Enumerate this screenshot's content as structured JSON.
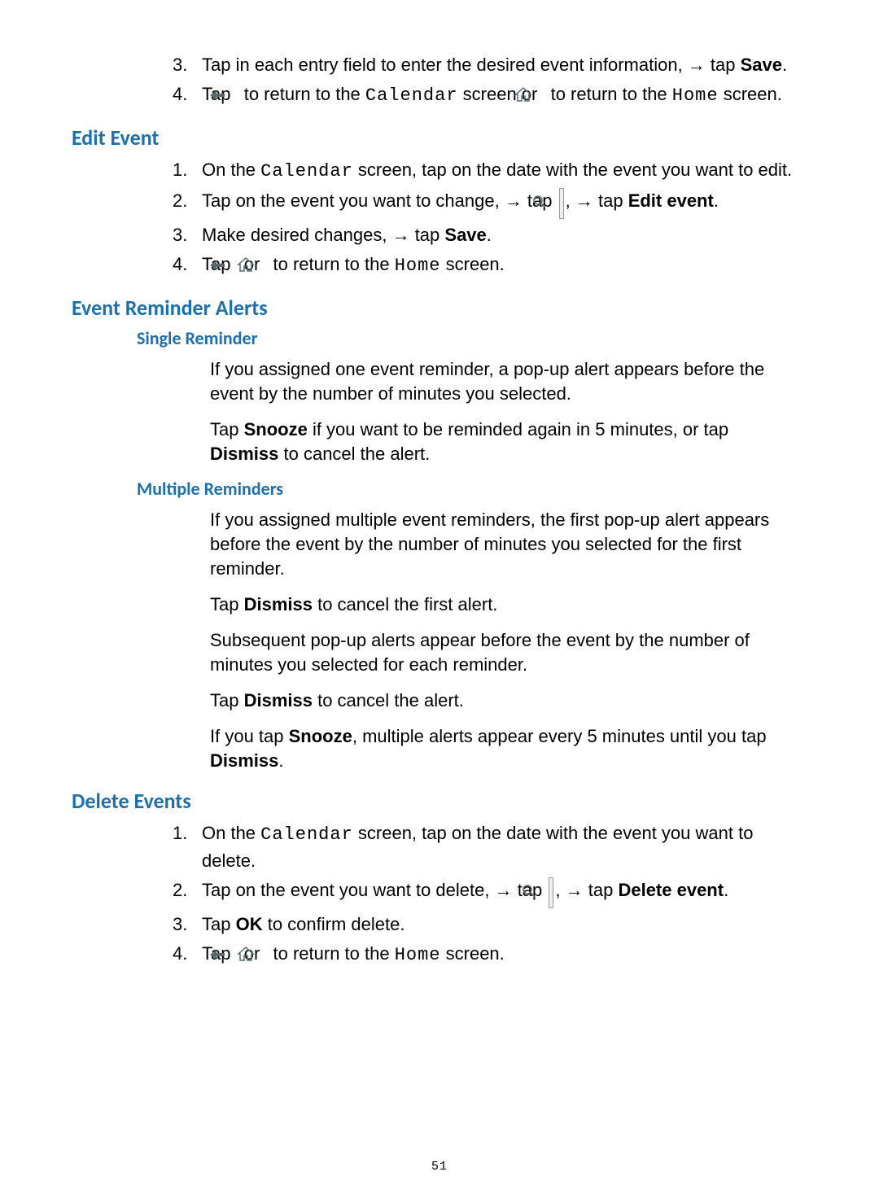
{
  "page_number": "51",
  "intro_steps": [
    {
      "n": "3.",
      "parts": [
        {
          "t": "Tap in each entry field to enter the desired event information, → tap "
        },
        {
          "t": "Save",
          "bold": true
        },
        {
          "t": "."
        }
      ]
    },
    {
      "n": "4.",
      "parts": [
        {
          "t": "Tap "
        },
        {
          "icon": "back-arrow-icon"
        },
        {
          "t": " to return to the "
        },
        {
          "t": "Calendar",
          "mono": true
        },
        {
          "t": " screen or "
        },
        {
          "icon": "home-icon"
        },
        {
          "t": " to return to the "
        },
        {
          "t": "Home",
          "mono": true
        },
        {
          "t": " screen."
        }
      ]
    }
  ],
  "sections": [
    {
      "heading": "Edit Event",
      "steps": [
        {
          "n": "1.",
          "parts": [
            {
              "t": "On the "
            },
            {
              "t": "Calendar",
              "mono": true
            },
            {
              "t": " screen, tap on the date with the event you want to edit."
            }
          ]
        },
        {
          "n": "2.",
          "parts": [
            {
              "t": "Tap on the event you want to change, → tap "
            },
            {
              "icon": "magnifier-icon",
              "boxed": true
            },
            {
              "t": ", → tap "
            },
            {
              "t": "Edit event",
              "bold": true
            },
            {
              "t": "."
            }
          ]
        },
        {
          "n": "3.",
          "parts": [
            {
              "t": "Make desired changes, → tap "
            },
            {
              "t": "Save",
              "bold": true
            },
            {
              "t": "."
            }
          ]
        },
        {
          "n": "4.",
          "parts": [
            {
              "t": "Tap "
            },
            {
              "icon": "back-arrow-icon"
            },
            {
              "t": " or "
            },
            {
              "icon": "home-icon"
            },
            {
              "t": " to return to the "
            },
            {
              "t": "Home",
              "mono": true
            },
            {
              "t": " screen."
            }
          ]
        }
      ]
    },
    {
      "heading": "Event Reminder Alerts",
      "subsections": [
        {
          "subheading": "Single Reminder",
          "paras": [
            [
              {
                "t": "If you assigned one event reminder, a pop-up alert appears before the event by the number of minutes you selected."
              }
            ],
            [
              {
                "t": "Tap "
              },
              {
                "t": "Snooze",
                "bold": true
              },
              {
                "t": " if you want to be reminded again in 5 minutes, or tap "
              },
              {
                "t": "Dismiss",
                "bold": true
              },
              {
                "t": " to cancel the alert."
              }
            ]
          ]
        },
        {
          "subheading": "Multiple Reminders",
          "paras": [
            [
              {
                "t": "If you assigned multiple event reminders, the first pop-up alert appears before the event by the number of minutes you selected for the first reminder."
              }
            ],
            [
              {
                "t": "Tap "
              },
              {
                "t": "Dismiss",
                "bold": true
              },
              {
                "t": " to cancel the first alert."
              }
            ],
            [
              {
                "t": "Subsequent pop-up alerts appear before the event by the number of minutes you selected for each reminder."
              }
            ],
            [
              {
                "t": "Tap "
              },
              {
                "t": "Dismiss",
                "bold": true
              },
              {
                "t": " to cancel the alert."
              }
            ],
            [
              {
                "t": "If you tap "
              },
              {
                "t": "Snooze",
                "bold": true
              },
              {
                "t": ", multiple alerts appear every 5 minutes until you tap "
              },
              {
                "t": "Dismiss",
                "bold": true
              },
              {
                "t": "."
              }
            ]
          ]
        }
      ]
    },
    {
      "heading": "Delete Events",
      "steps": [
        {
          "n": "1.",
          "parts": [
            {
              "t": "On the "
            },
            {
              "t": "Calendar",
              "mono": true
            },
            {
              "t": " screen, tap on the date with the event you want to delete."
            }
          ]
        },
        {
          "n": "2.",
          "parts": [
            {
              "t": "Tap on the event you want to delete, → tap "
            },
            {
              "icon": "magnifier-icon",
              "boxed": true
            },
            {
              "t": ", → tap "
            },
            {
              "t": "Delete event",
              "bold": true
            },
            {
              "t": "."
            }
          ]
        },
        {
          "n": "3.",
          "parts": [
            {
              "t": "Tap "
            },
            {
              "t": "OK",
              "bold": true
            },
            {
              "t": " to confirm delete."
            }
          ]
        },
        {
          "n": "4.",
          "parts": [
            {
              "t": "Tap "
            },
            {
              "icon": "back-arrow-icon"
            },
            {
              "t": " or "
            },
            {
              "icon": "home-icon"
            },
            {
              "t": " to return to the "
            },
            {
              "t": "Home",
              "mono": true
            },
            {
              "t": " screen."
            }
          ]
        }
      ]
    }
  ]
}
